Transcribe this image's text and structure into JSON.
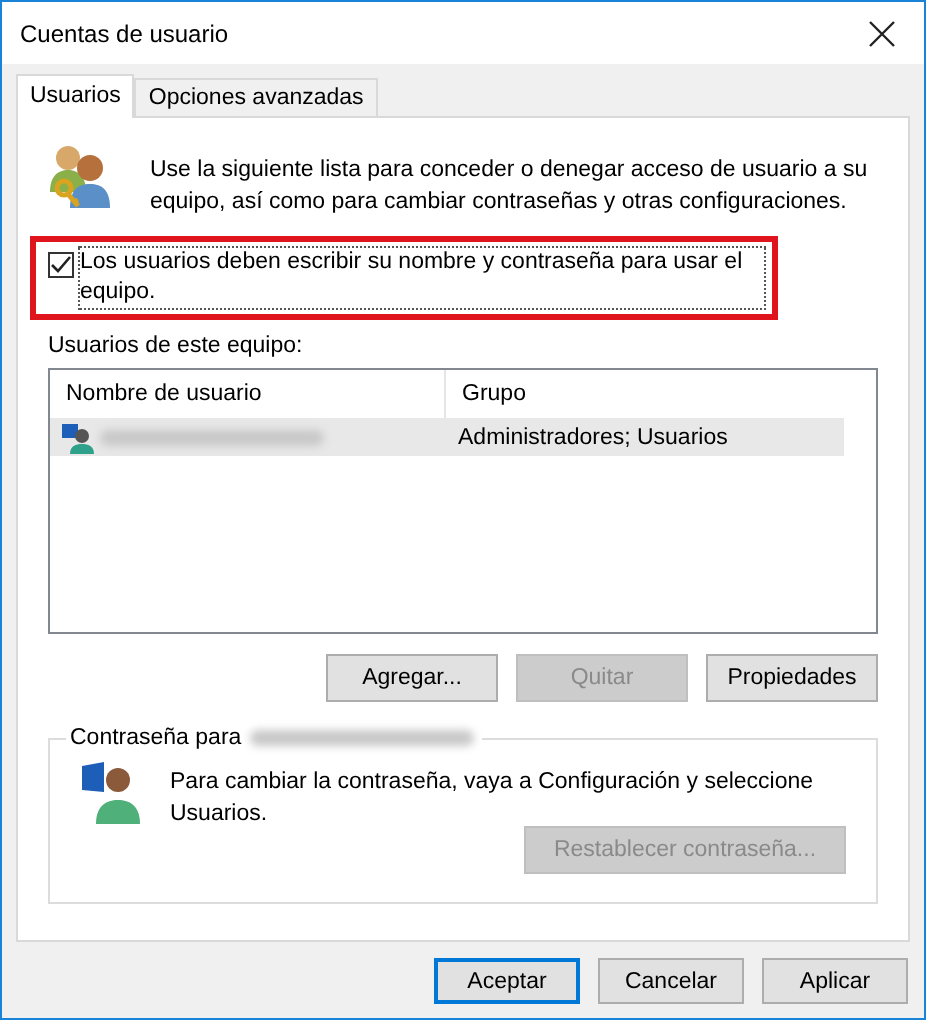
{
  "window": {
    "title": "Cuentas de usuario"
  },
  "tabs": [
    {
      "label": "Usuarios",
      "selected": true
    },
    {
      "label": "Opciones avanzadas",
      "selected": false
    }
  ],
  "intro": "Use la siguiente lista para conceder o denegar acceso de usuario a su equipo, así como para cambiar contraseñas y otras configuraciones.",
  "require_login": {
    "label": "Los usuarios deben escribir su nombre y contraseña para usar el equipo.",
    "checked": true,
    "highlighted": true
  },
  "users_label": "Usuarios de este equipo:",
  "table": {
    "columns": [
      "Nombre de usuario",
      "Grupo"
    ],
    "rows": [
      {
        "group": "Administradores; Usuarios",
        "selected": true
      }
    ]
  },
  "list_buttons": [
    {
      "label": "Agregar...",
      "disabled": false
    },
    {
      "label": "Quitar",
      "disabled": true
    },
    {
      "label": "Propiedades",
      "disabled": false
    }
  ],
  "password_group": {
    "legend": "Contraseña para",
    "message": "Para cambiar la contraseña, vaya a Configuración y seleccione Usuarios.",
    "button": {
      "label": "Restablecer contraseña...",
      "disabled": true
    }
  },
  "dialog_buttons": [
    {
      "label": "Aceptar",
      "default": true
    },
    {
      "label": "Cancelar",
      "default": false
    },
    {
      "label": "Aplicar",
      "default": false
    }
  ]
}
